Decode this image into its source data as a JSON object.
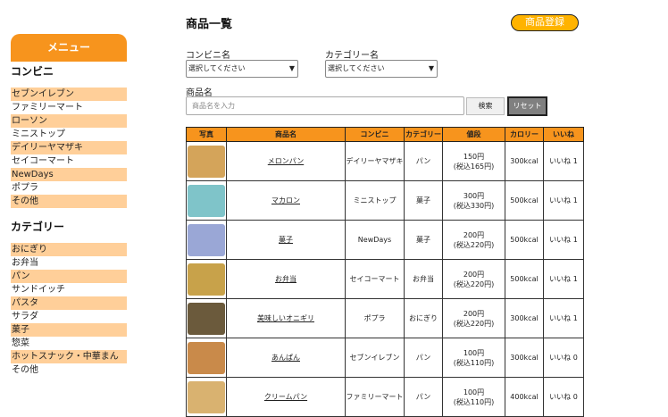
{
  "sidebar": {
    "header": "メニュー",
    "convenience_title": "コンビニ",
    "convenience_items": [
      {
        "label": "セブンイレブン",
        "highlight": true
      },
      {
        "label": "ファミリーマート",
        "highlight": false
      },
      {
        "label": "ローソン",
        "highlight": true
      },
      {
        "label": "ミニストップ",
        "highlight": false
      },
      {
        "label": "デイリーヤマザキ",
        "highlight": true
      },
      {
        "label": "セイコーマート",
        "highlight": false
      },
      {
        "label": "NewDays",
        "highlight": true
      },
      {
        "label": "ポプラ",
        "highlight": false
      },
      {
        "label": "その他",
        "highlight": true
      }
    ],
    "category_title": "カテゴリー",
    "category_items": [
      {
        "label": "おにぎり",
        "highlight": true
      },
      {
        "label": "お弁当",
        "highlight": false
      },
      {
        "label": "パン",
        "highlight": true
      },
      {
        "label": "サンドイッチ",
        "highlight": false
      },
      {
        "label": "パスタ",
        "highlight": true
      },
      {
        "label": "サラダ",
        "highlight": false
      },
      {
        "label": "菓子",
        "highlight": true
      },
      {
        "label": "惣菜",
        "highlight": false
      },
      {
        "label": "ホットスナック・中華まん",
        "highlight": true
      },
      {
        "label": "その他",
        "highlight": false
      }
    ]
  },
  "main": {
    "title": "商品一覧",
    "register_label": "商品登録",
    "store_label": "コンビニ名",
    "store_select": "選択してください",
    "category_label": "カテゴリー名",
    "category_select": "選択してください",
    "name_label": "商品名",
    "name_placeholder": "商品名を入力",
    "search_label": "検索",
    "reset_label": "リセット"
  },
  "table": {
    "headers": [
      "写真",
      "商品名",
      "コンビニ",
      "カテゴリー",
      "値段",
      "カロリー",
      "いいね"
    ],
    "rows": [
      {
        "name": "メロンパン",
        "store": "デイリーヤマザキ",
        "category": "パン",
        "price": "150円",
        "price_tax": "(税込165円)",
        "calorie": "300kcal",
        "like": "いいね 1",
        "photo_color": "#d4a45a"
      },
      {
        "name": "マカロン",
        "store": "ミニストップ",
        "category": "菓子",
        "price": "300円",
        "price_tax": "(税込330円)",
        "calorie": "500kcal",
        "like": "いいね 1",
        "photo_color": "#7fc4c9"
      },
      {
        "name": "菓子",
        "store": "NewDays",
        "category": "菓子",
        "price": "200円",
        "price_tax": "(税込220円)",
        "calorie": "500kcal",
        "like": "いいね 1",
        "photo_color": "#9aa7d6"
      },
      {
        "name": "お弁当",
        "store": "セイコーマート",
        "category": "お弁当",
        "price": "200円",
        "price_tax": "(税込220円)",
        "calorie": "500kcal",
        "like": "いいね 1",
        "photo_color": "#c8a24a"
      },
      {
        "name": "美味しいオニギリ",
        "store": "ポプラ",
        "category": "おにぎり",
        "price": "200円",
        "price_tax": "(税込220円)",
        "calorie": "300kcal",
        "like": "いいね 1",
        "photo_color": "#6b5a3c"
      },
      {
        "name": "あんぱん",
        "store": "セブンイレブン",
        "category": "パン",
        "price": "100円",
        "price_tax": "(税込110円)",
        "calorie": "300kcal",
        "like": "いいね 0",
        "photo_color": "#c98a4a"
      },
      {
        "name": "クリームパン",
        "store": "ファミリーマート",
        "category": "パン",
        "price": "100円",
        "price_tax": "(税込110円)",
        "calorie": "400kcal",
        "like": "いいね 0",
        "photo_color": "#d9b270"
      }
    ]
  },
  "colors": {
    "accent": "#f7941d",
    "highlight": "#ffcf99",
    "register": "#ffb300",
    "like": "#e53935"
  }
}
